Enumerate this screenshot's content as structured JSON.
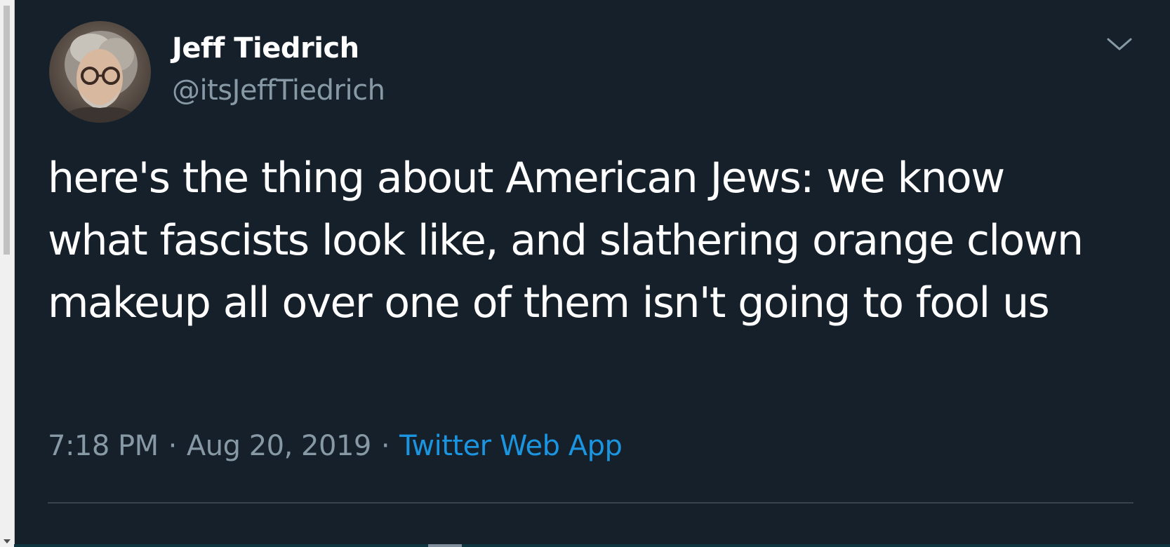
{
  "tweet": {
    "author": {
      "name": "Jeff Tiedrich",
      "handle": "@itsJeffTiedrich",
      "avatar_icon": "user-avatar-photo"
    },
    "text": "here's the thing about American Jews: we know what fascists look like, and slathering orange clown makeup all over one of them isn't going to fool us",
    "time": "7:18 PM",
    "date": "Aug 20, 2019",
    "separator": "·",
    "source": "Twitter Web App",
    "menu_icon": "chevron-down-icon"
  },
  "colors": {
    "background": "#15202b",
    "text_primary": "#ffffff",
    "text_secondary": "#8899a6",
    "link": "#1b95e0",
    "divider": "#38444d"
  }
}
